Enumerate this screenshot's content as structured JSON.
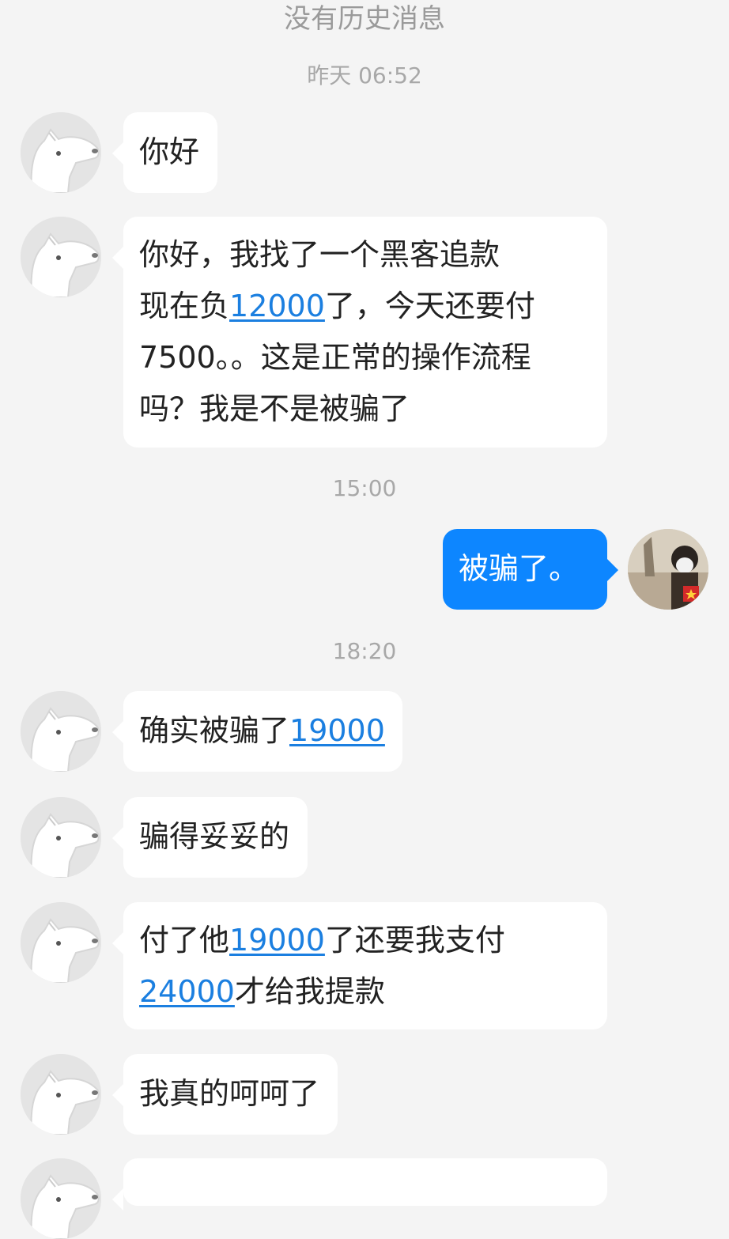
{
  "header": {
    "no_history": "没有历史消息"
  },
  "timestamps": [
    "昨天 06:52",
    "15:00",
    "18:20"
  ],
  "messages": [
    {
      "side": "left",
      "lines": [
        [
          {
            "t": "你好"
          }
        ]
      ]
    },
    {
      "side": "left",
      "lines": [
        [
          {
            "t": "你好，我找了一个黑客追款"
          }
        ],
        [
          {
            "t": "现在负"
          },
          {
            "t": "12000",
            "link": true
          },
          {
            "t": "了，今天还要付"
          }
        ],
        [
          {
            "t": "7500。。这是正常的操作流程"
          }
        ],
        [
          {
            "t": "吗？我是不是被骗了"
          }
        ]
      ]
    },
    {
      "side": "right",
      "lines": [
        [
          {
            "t": "被骗了。"
          }
        ]
      ]
    },
    {
      "side": "left",
      "lines": [
        [
          {
            "t": "确实被骗了"
          },
          {
            "t": "19000",
            "link": true
          }
        ]
      ]
    },
    {
      "side": "left",
      "lines": [
        [
          {
            "t": "骗得妥妥的"
          }
        ]
      ]
    },
    {
      "side": "left",
      "lines": [
        [
          {
            "t": "付了他"
          },
          {
            "t": "19000",
            "link": true
          },
          {
            "t": "了还要我支付"
          }
        ],
        [
          {
            "t": "24000",
            "link": true
          },
          {
            "t": "才给我提款"
          }
        ]
      ]
    },
    {
      "side": "left",
      "lines": [
        [
          {
            "t": "我真的呵呵了"
          }
        ]
      ]
    }
  ],
  "colors": {
    "accent": "#0d86ff",
    "link": "#1b7fe0",
    "background": "#f4f4f4"
  },
  "icons": {
    "other_avatar": "dog-avatar-icon",
    "self_avatar": "user-photo-avatar"
  }
}
